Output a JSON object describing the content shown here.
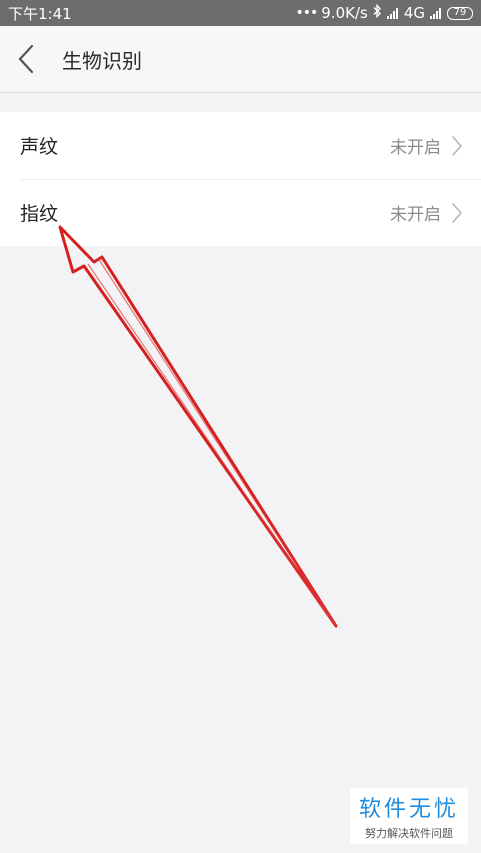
{
  "status_bar": {
    "time": "下午1:41",
    "network_speed": "9.0K/s",
    "network_type": "4G",
    "battery": "79"
  },
  "header": {
    "title": "生物识别",
    "back_icon": "chevron-left-icon"
  },
  "settings": {
    "items": [
      {
        "label": "声纹",
        "status": "未开启"
      },
      {
        "label": "指纹",
        "status": "未开启"
      }
    ]
  },
  "annotation": {
    "type": "red-arrow",
    "points_to": "指纹",
    "color": "#d62020"
  },
  "watermark": {
    "title": "软件无忧",
    "subtitle": "努力解决软件问题",
    "color": "#1e8ce0"
  },
  "colors": {
    "status_bar_bg": "#6d6d6d",
    "page_bg": "#f3f3f5",
    "row_bg": "#ffffff"
  }
}
